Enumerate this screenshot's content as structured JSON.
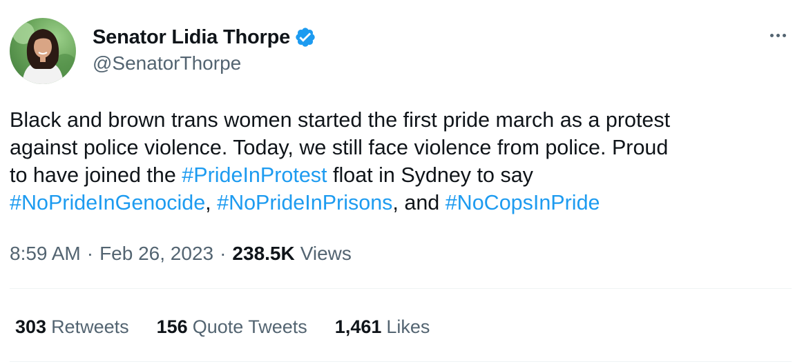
{
  "author": {
    "display_name": "Senator Lidia Thorpe",
    "handle": "@SenatorThorpe",
    "verified": true
  },
  "tweet": {
    "text_lines": [
      [
        {
          "t": "Black and brown trans women started the first pride march as a protest",
          "tag": false
        }
      ],
      [
        {
          "t": "against police violence. Today, we still face violence from police. Proud",
          "tag": false
        }
      ],
      [
        {
          "t": "to have joined the ",
          "tag": false
        },
        {
          "t": "#PrideInProtest",
          "tag": true
        },
        {
          "t": " float in Sydney to say",
          "tag": false
        }
      ],
      [
        {
          "t": "#NoPrideInGenocide",
          "tag": true
        },
        {
          "t": ", ",
          "tag": false
        },
        {
          "t": "#NoPrideInPrisons",
          "tag": true
        },
        {
          "t": ", and ",
          "tag": false
        },
        {
          "t": "#NoCopsInPride",
          "tag": true
        }
      ]
    ]
  },
  "meta": {
    "time": "8:59 AM",
    "separator": "·",
    "date": "Feb 26, 2023",
    "views_count": "238.5K",
    "views_label": "Views"
  },
  "stats": {
    "retweets": {
      "count": "303",
      "label": "Retweets"
    },
    "quote_tweets": {
      "count": "156",
      "label": "Quote Tweets"
    },
    "likes": {
      "count": "1,461",
      "label": "Likes"
    }
  },
  "colors": {
    "text": "#0f1419",
    "secondary": "#536471",
    "link": "#1d9bf0",
    "divider": "#eff3f4"
  },
  "icons": {
    "verified": "verified-badge-icon",
    "more": "more-options-icon",
    "avatar": "profile-photo"
  }
}
